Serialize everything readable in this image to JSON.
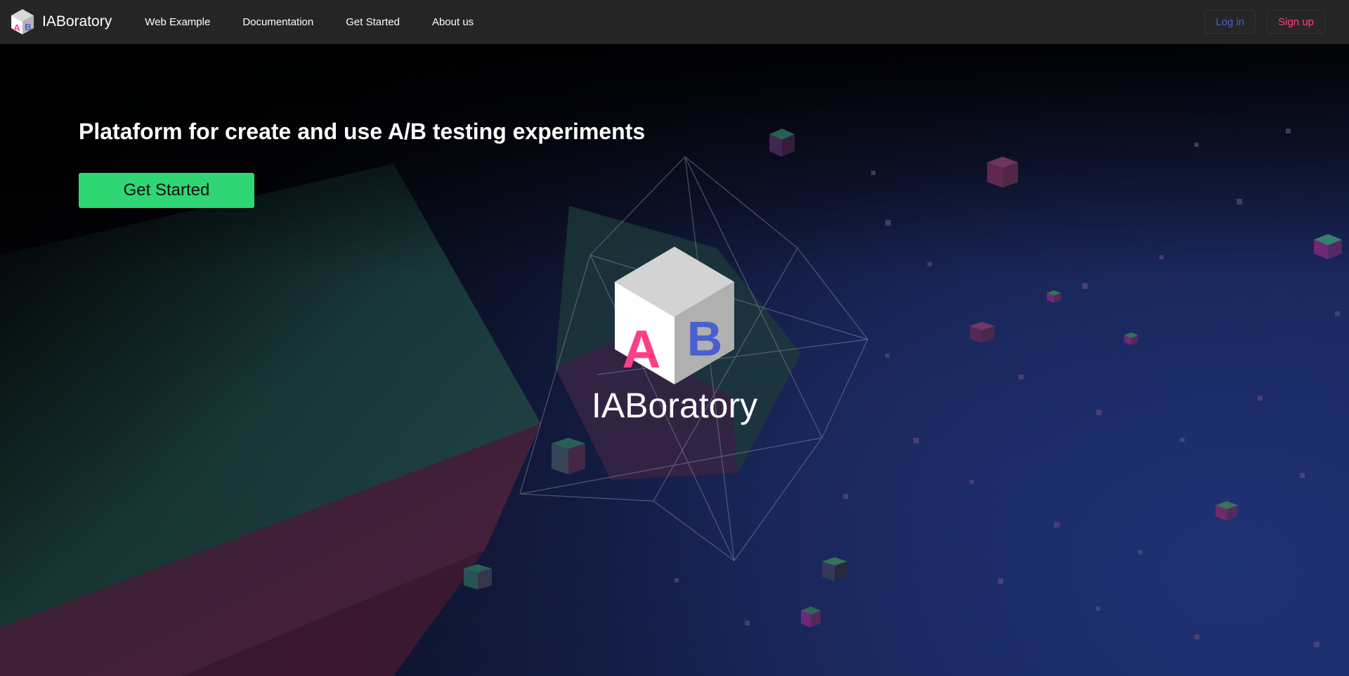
{
  "brand": {
    "name": "IABoratory",
    "logo_icon": "ab-cube-icon"
  },
  "nav": {
    "items": [
      {
        "label": "Web Example"
      },
      {
        "label": "Documentation"
      },
      {
        "label": "Get Started"
      },
      {
        "label": "About us"
      }
    ],
    "login_label": "Log in",
    "signup_label": "Sign up"
  },
  "hero": {
    "headline": "Plataform for create and use A/B testing experiments",
    "cta_label": "Get Started",
    "logo_title": "IABoratory",
    "logo_letters": {
      "a": "A",
      "b": "B"
    }
  },
  "colors": {
    "accent_green": "#2fd673",
    "pink": "#ff3e86",
    "blue": "#4a5fd0",
    "navbar": "#252525"
  }
}
